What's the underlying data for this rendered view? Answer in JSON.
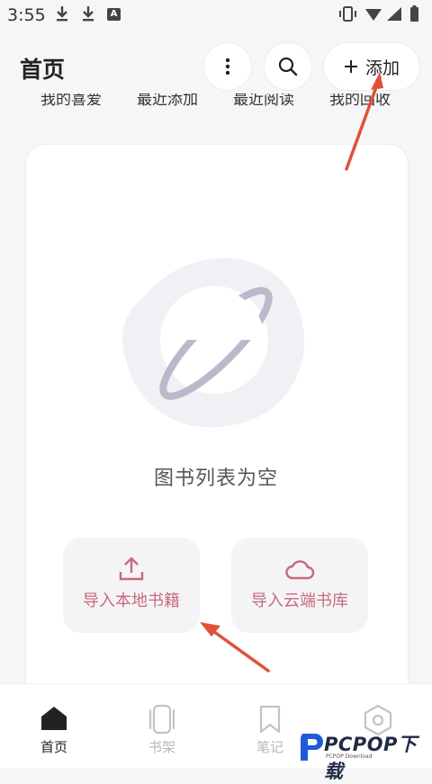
{
  "status_bar": {
    "time": "3:55",
    "a_badge": "A"
  },
  "header": {
    "title": "首页",
    "add_label": "添加"
  },
  "chips": [
    "我的喜爱",
    "最近添加",
    "最近阅读",
    "我的回收"
  ],
  "empty_state": {
    "message": "图书列表为空",
    "import_local": "导入本地书籍",
    "import_cloud": "导入云端书库"
  },
  "bottom_nav": [
    {
      "label": "首页",
      "icon": "home-icon",
      "active": true
    },
    {
      "label": "书架",
      "icon": "bookshelf-icon",
      "active": false
    },
    {
      "label": "笔记",
      "icon": "bookmark-icon",
      "active": false
    },
    {
      "label": "",
      "icon": "settings-icon",
      "active": false
    }
  ],
  "watermark": {
    "brand": "PCPOP下载",
    "sub": "PCPOP Download"
  },
  "colors": {
    "accent": "#c76a79",
    "arrow": "#e0513a",
    "inactive": "#c2c2c8"
  }
}
